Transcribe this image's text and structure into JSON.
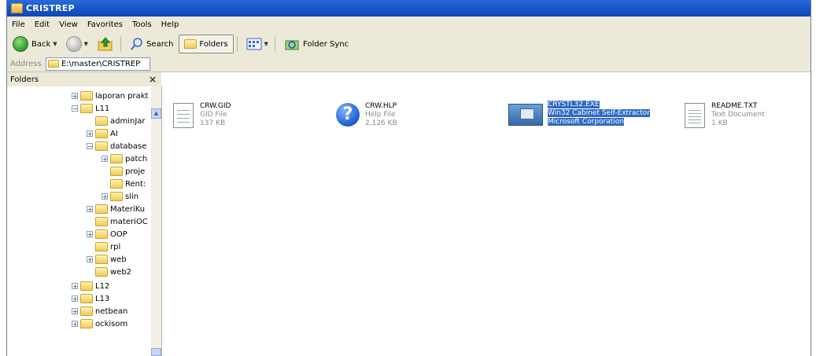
{
  "window": {
    "title": "CRISTREP"
  },
  "menu": [
    "File",
    "Edit",
    "View",
    "Favorites",
    "Tools",
    "Help"
  ],
  "toolbar": {
    "back": "Back",
    "search": "Search",
    "folders": "Folders",
    "folder_sync": "Folder Sync"
  },
  "address": {
    "label": "Address",
    "path": "E:\\master\\CRISTREP"
  },
  "folders_pane": {
    "title": "Folders",
    "close": "×",
    "tree": [
      {
        "label": "laporan prakt",
        "expander": "+"
      },
      {
        "label": "L11",
        "expander": "−"
      },
      {
        "label": "adminJar",
        "expander": ""
      },
      {
        "label": "AI",
        "expander": "+"
      },
      {
        "label": "database",
        "expander": "−"
      },
      {
        "label": "patch",
        "expander": "+"
      },
      {
        "label": "proje",
        "expander": ""
      },
      {
        "label": "Rent:",
        "expander": ""
      },
      {
        "label": "slin",
        "expander": "+"
      },
      {
        "label": "MateriKu",
        "expander": "+"
      },
      {
        "label": "materiOC",
        "expander": ""
      },
      {
        "label": "OOP",
        "expander": "+"
      },
      {
        "label": "rpl",
        "expander": ""
      },
      {
        "label": "web",
        "expander": "+"
      },
      {
        "label": "web2",
        "expander": ""
      },
      {
        "label": "L12",
        "expander": "+"
      },
      {
        "label": "L13",
        "expander": "+"
      },
      {
        "label": "netbean",
        "expander": "+"
      },
      {
        "label": "ockisom",
        "expander": "+"
      }
    ]
  },
  "files": [
    {
      "name": "CRW.GID",
      "type": "GID File",
      "detail": "137 KB",
      "icon": "gid-file-icon"
    },
    {
      "name": "CRW.HLP",
      "type": "Help File",
      "detail": "2,126 KB",
      "icon": "help-file-icon"
    },
    {
      "name": "CRYSTL32.EXE",
      "type": "Win32 Cabinet Self-Extractor",
      "detail": "Microsoft Corporation",
      "icon": "cabinet-exe-icon",
      "selected": true
    },
    {
      "name": "README.TXT",
      "type": "Text Document",
      "detail": "1 KB",
      "icon": "text-document-icon"
    }
  ],
  "colors": {
    "title_bar": "#1553c7",
    "selection": "#316ac5",
    "chrome": "#ece9d8"
  }
}
